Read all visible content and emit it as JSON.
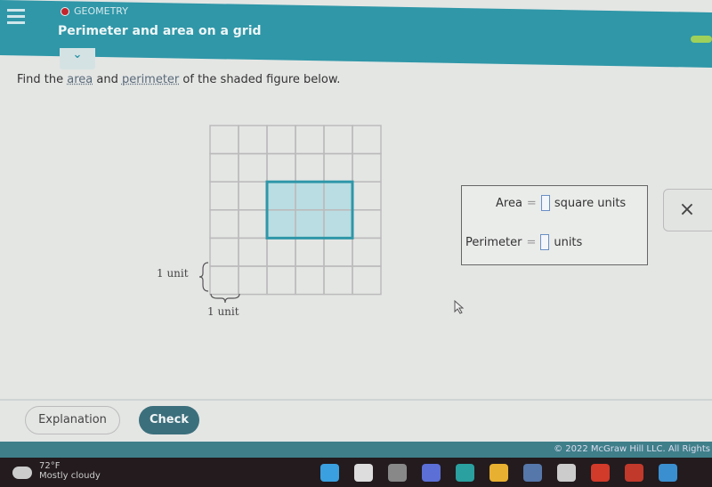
{
  "header": {
    "category": "GEOMETRY",
    "title": "Perimeter and area on a grid",
    "progress_color": "#9fd05a",
    "accent": "#2f97a8"
  },
  "question": {
    "prefix": "Find the ",
    "link1": "area",
    "mid": " and ",
    "link2": "perimeter",
    "suffix": " of the shaded figure below."
  },
  "grid": {
    "columns": 6,
    "rows": 6,
    "shaded": {
      "col_start": 2,
      "row_start": 2,
      "width": 3,
      "height": 2
    },
    "shade_color": "#b9dde2",
    "border_color": "#2f97a8",
    "unit_label_vertical": "1 unit",
    "unit_label_horizontal": "1 unit"
  },
  "answer": {
    "area_label": "Area",
    "area_units": "square units",
    "perimeter_label": "Perimeter",
    "perimeter_units": "units",
    "equals": "=",
    "area_value": "",
    "perimeter_value": ""
  },
  "buttons": {
    "close": "×",
    "explanation": "Explanation",
    "check": "Check"
  },
  "footer": "© 2022 McGraw Hill LLC. All Rights",
  "taskbar": {
    "temp": "72°F",
    "weather": "Mostly cloudy",
    "icons": [
      "windows-start",
      "search",
      "task-view",
      "teams-chat",
      "edge",
      "file-explorer",
      "microsoft-store",
      "dell-app",
      "youtube-music",
      "office",
      "mail"
    ]
  }
}
